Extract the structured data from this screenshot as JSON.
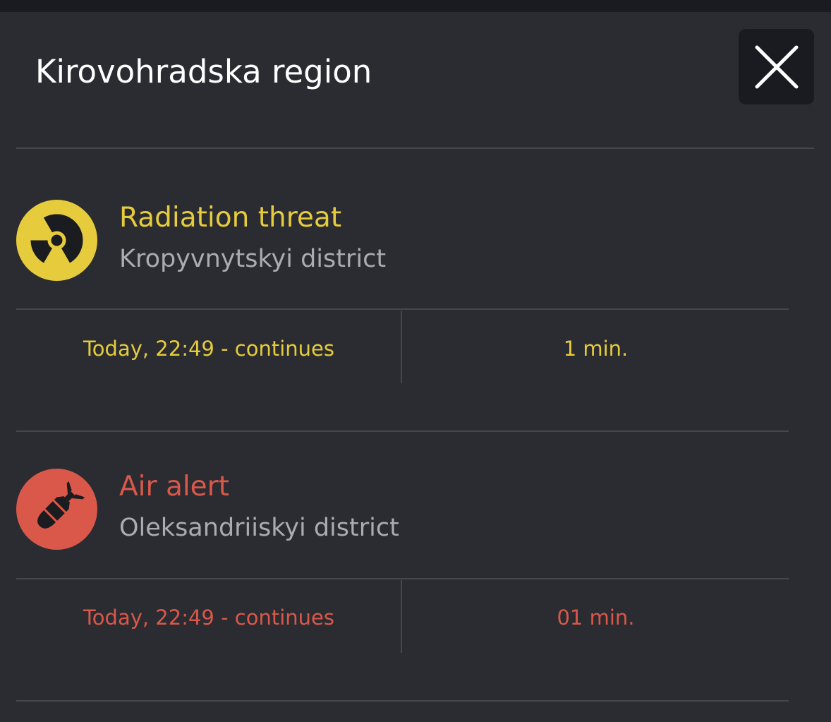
{
  "region_title": "Kirovohradska region",
  "close_icon": "close-icon",
  "alerts": [
    {
      "type": "Radiation threat",
      "district": "Kropyvnytskyi district",
      "time": "Today, 22:49 - continues",
      "duration": "1 min.",
      "icon": "radiation-icon",
      "color": "#e6cc3c"
    },
    {
      "type": "Air alert",
      "district": "Oleksandriiskyi district",
      "time": "Today, 22:49 - continues",
      "duration": "01 min.",
      "icon": "missile-icon",
      "color": "#d9584a"
    }
  ]
}
